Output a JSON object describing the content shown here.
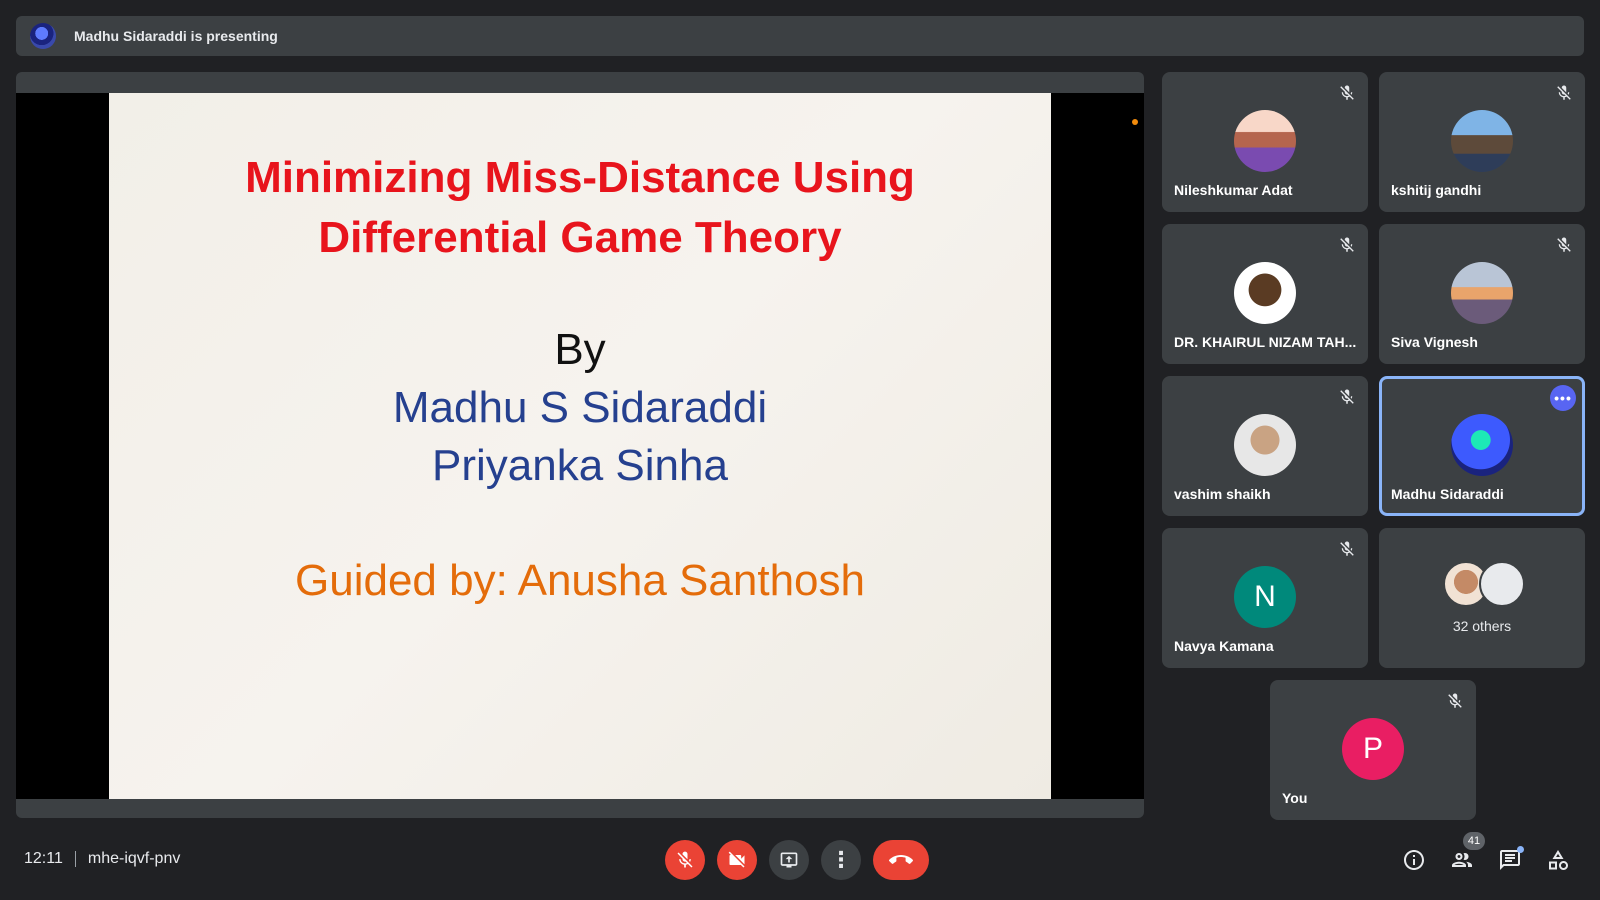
{
  "presenting_bar": {
    "text": "Madhu Sidaraddi is presenting"
  },
  "slide": {
    "title_line1": "Minimizing Miss-Distance Using",
    "title_line2": "Differential Game Theory",
    "by": "By",
    "author1": "Madhu S Sidaraddi",
    "author2": "Priyanka Sinha",
    "guide": "Guided by: Anusha Santhosh"
  },
  "participants": [
    {
      "name": "Nileshkumar Adat",
      "muted": true
    },
    {
      "name": "kshitij gandhi",
      "muted": true
    },
    {
      "name": "DR. KHAIRUL NIZAM TAH...",
      "muted": true
    },
    {
      "name": "Siva Vignesh",
      "muted": true
    },
    {
      "name": "vashim shaikh",
      "muted": true
    },
    {
      "name": "Madhu Sidaraddi",
      "muted": false,
      "speaking_highlight": true
    },
    {
      "name": "Navya Kamana",
      "initial": "N",
      "color": "#00897b",
      "muted": true
    },
    {
      "name": "You",
      "initial": "P",
      "color": "#e91e63",
      "muted": true
    }
  ],
  "others": {
    "label": "32 others"
  },
  "meeting": {
    "time": "12:11",
    "code": "mhe-iqvf-pnv"
  },
  "controls": {
    "more_label": "⋮"
  },
  "people_count": "41",
  "colors": {
    "accent": "#8ab4f8",
    "danger": "#ea4335",
    "tile_bg": "#3c4043",
    "page_bg": "#202124"
  }
}
